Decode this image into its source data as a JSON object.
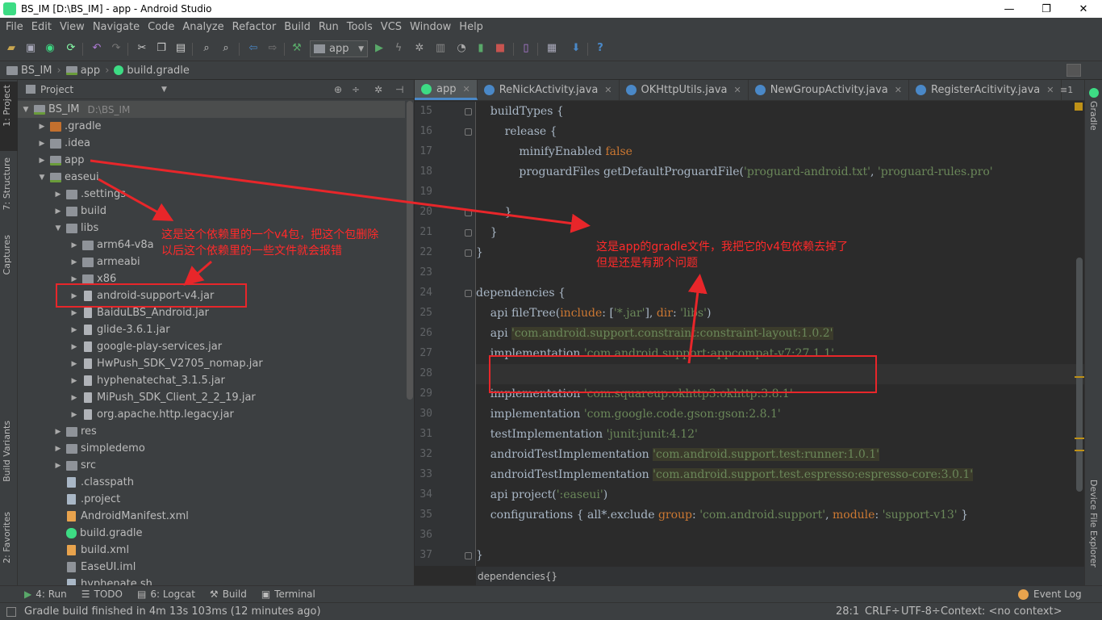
{
  "window": {
    "title": "BS_IM [D:\\BS_IM] - app - Android Studio",
    "controls": [
      "—",
      "❐",
      "✕"
    ]
  },
  "menu": [
    "File",
    "Edit",
    "View",
    "Navigate",
    "Code",
    "Analyze",
    "Refactor",
    "Build",
    "Run",
    "Tools",
    "VCS",
    "Window",
    "Help"
  ],
  "toolbar": {
    "run_config": "app"
  },
  "breadcrumb": [
    "BS_IM",
    "app",
    "build.gradle"
  ],
  "left_strip": {
    "project": "1: Project",
    "structure": "7: Structure",
    "captures": "Captures",
    "build_variants": "Build Variants",
    "favorites": "2: Favorites"
  },
  "right_strip": {
    "gradle": "Gradle",
    "device_explorer": "Device File Explorer"
  },
  "project_panel": {
    "view": "Project",
    "root": {
      "name": "BS_IM",
      "path": "D:\\BS_IM"
    },
    "tree": [
      {
        "label": "BS_IM",
        "extra": "D:\\BS_IM",
        "depth": 0,
        "arrow": "down",
        "icon": "mod"
      },
      {
        "label": ".gradle",
        "depth": 1,
        "arrow": "right",
        "icon": "ofolder"
      },
      {
        "label": ".idea",
        "depth": 1,
        "arrow": "right",
        "icon": "folder"
      },
      {
        "label": "app",
        "depth": 1,
        "arrow": "right",
        "icon": "mod"
      },
      {
        "label": "easeui",
        "depth": 1,
        "arrow": "down",
        "icon": "mod"
      },
      {
        "label": ".settings",
        "depth": 2,
        "arrow": "right",
        "icon": "folder"
      },
      {
        "label": "build",
        "depth": 2,
        "arrow": "right",
        "icon": "folder"
      },
      {
        "label": "libs",
        "depth": 2,
        "arrow": "down",
        "icon": "folder"
      },
      {
        "label": "arm64-v8a",
        "depth": 3,
        "arrow": "right",
        "icon": "folder"
      },
      {
        "label": "armeabi",
        "depth": 3,
        "arrow": "right",
        "icon": "folder"
      },
      {
        "label": "x86",
        "depth": 3,
        "arrow": "right",
        "icon": "folder"
      },
      {
        "label": "android-support-v4.jar",
        "depth": 3,
        "arrow": "right",
        "icon": "jar"
      },
      {
        "label": "BaiduLBS_Android.jar",
        "depth": 3,
        "arrow": "right",
        "icon": "jar"
      },
      {
        "label": "glide-3.6.1.jar",
        "depth": 3,
        "arrow": "right",
        "icon": "jar"
      },
      {
        "label": "google-play-services.jar",
        "depth": 3,
        "arrow": "right",
        "icon": "jar"
      },
      {
        "label": "HwPush_SDK_V2705_nomap.jar",
        "depth": 3,
        "arrow": "right",
        "icon": "jar"
      },
      {
        "label": "hyphenatechat_3.1.5.jar",
        "depth": 3,
        "arrow": "right",
        "icon": "jar"
      },
      {
        "label": "MiPush_SDK_Client_2_2_19.jar",
        "depth": 3,
        "arrow": "right",
        "icon": "jar"
      },
      {
        "label": "org.apache.http.legacy.jar",
        "depth": 3,
        "arrow": "right",
        "icon": "jar"
      },
      {
        "label": "res",
        "depth": 2,
        "arrow": "right",
        "icon": "folder"
      },
      {
        "label": "simpledemo",
        "depth": 2,
        "arrow": "right",
        "icon": "folder"
      },
      {
        "label": "src",
        "depth": 2,
        "arrow": "right",
        "icon": "folder"
      },
      {
        "label": ".classpath",
        "depth": 2,
        "arrow": "none",
        "icon": "file"
      },
      {
        "label": ".project",
        "depth": 2,
        "arrow": "none",
        "icon": "file"
      },
      {
        "label": "AndroidManifest.xml",
        "depth": 2,
        "arrow": "none",
        "icon": "xml"
      },
      {
        "label": "build.gradle",
        "depth": 2,
        "arrow": "none",
        "icon": "grad"
      },
      {
        "label": "build.xml",
        "depth": 2,
        "arrow": "none",
        "icon": "xml"
      },
      {
        "label": "EaseUI.iml",
        "depth": 2,
        "arrow": "none",
        "icon": "iml"
      },
      {
        "label": "hyphenate.sh",
        "depth": 2,
        "arrow": "none",
        "icon": "file"
      }
    ]
  },
  "editor": {
    "tabs": [
      {
        "label": "app",
        "active": true,
        "color": "#3ddc84"
      },
      {
        "label": "ReNickActivity.java",
        "active": false,
        "color": "#4a88c7"
      },
      {
        "label": "OKHttpUtils.java",
        "active": false,
        "color": "#4a88c7"
      },
      {
        "label": "NewGroupActivity.java",
        "active": false,
        "color": "#4a88c7"
      },
      {
        "label": "RegisterAcitivity.java",
        "active": false,
        "color": "#4a88c7"
      }
    ],
    "tab_menu": "≡1",
    "lines": [
      {
        "n": "15",
        "segs": [
          [
            "    buildTypes {",
            ""
          ]
        ]
      },
      {
        "n": "16",
        "segs": [
          [
            "        release {",
            ""
          ]
        ]
      },
      {
        "n": "17",
        "segs": [
          [
            "            minifyEnabled ",
            ""
          ],
          [
            "false",
            "kw"
          ]
        ]
      },
      {
        "n": "18",
        "segs": [
          [
            "            proguardFiles getDefaultProguardFile(",
            ""
          ],
          [
            "'proguard-android.txt'",
            "str"
          ],
          [
            ", ",
            ""
          ],
          [
            "'proguard-rules.pro'",
            "str"
          ]
        ]
      },
      {
        "n": "19",
        "segs": [
          [
            "",
            ""
          ]
        ]
      },
      {
        "n": "20",
        "segs": [
          [
            "        }",
            ""
          ]
        ]
      },
      {
        "n": "21",
        "segs": [
          [
            "    }",
            ""
          ]
        ]
      },
      {
        "n": "22",
        "segs": [
          [
            "}",
            ""
          ]
        ]
      },
      {
        "n": "23",
        "segs": [
          [
            "",
            ""
          ]
        ]
      },
      {
        "n": "24",
        "segs": [
          [
            "dependencies {",
            ""
          ]
        ]
      },
      {
        "n": "25",
        "segs": [
          [
            "    api fileTree(",
            ""
          ],
          [
            "include",
            "lit"
          ],
          [
            ": [",
            ""
          ],
          [
            "'*.jar'",
            "str"
          ],
          [
            "], ",
            ""
          ],
          [
            "dir",
            "lit"
          ],
          [
            ": ",
            ""
          ],
          [
            "'libs'",
            "str"
          ],
          [
            ")",
            ""
          ]
        ]
      },
      {
        "n": "26",
        "segs": [
          [
            "    api ",
            ""
          ],
          [
            "'com.android.support.constraint:constraint-layout:1.0.2'",
            "str hl"
          ]
        ]
      },
      {
        "n": "27",
        "segs": [
          [
            "    implementation ",
            ""
          ],
          [
            "'com.android.support:appcompat-v7:27.1.1'",
            "str"
          ]
        ]
      },
      {
        "n": "28",
        "segs": [
          [
            "",
            ""
          ]
        ]
      },
      {
        "n": "29",
        "segs": [
          [
            "    implementation ",
            ""
          ],
          [
            "'com.squareup.okhttp3:okhttp:3.8.1'",
            "str"
          ]
        ]
      },
      {
        "n": "30",
        "segs": [
          [
            "    implementation ",
            ""
          ],
          [
            "'com.google.code.gson:gson:2.8.1'",
            "str"
          ]
        ]
      },
      {
        "n": "31",
        "segs": [
          [
            "    testImplementation ",
            ""
          ],
          [
            "'junit:junit:4.12'",
            "str"
          ]
        ]
      },
      {
        "n": "32",
        "segs": [
          [
            "    androidTestImplementation ",
            ""
          ],
          [
            "'com.android.support.test:runner:1.0.1'",
            "str hl"
          ]
        ]
      },
      {
        "n": "33",
        "segs": [
          [
            "    androidTestImplementation ",
            ""
          ],
          [
            "'com.android.support.test.espresso:espresso-core:3.0.1'",
            "str hl"
          ]
        ]
      },
      {
        "n": "34",
        "segs": [
          [
            "    api project(",
            ""
          ],
          [
            "':easeui'",
            "str"
          ],
          [
            ")",
            ""
          ]
        ]
      },
      {
        "n": "35",
        "segs": [
          [
            "    configurations { all*.exclude ",
            ""
          ],
          [
            "group",
            "lit"
          ],
          [
            ": ",
            ""
          ],
          [
            "'com.android.support'",
            "str"
          ],
          [
            ", ",
            ""
          ],
          [
            "module",
            "lit"
          ],
          [
            ": ",
            ""
          ],
          [
            "'support-v13'",
            "str"
          ],
          [
            " }",
            ""
          ]
        ]
      },
      {
        "n": "36",
        "segs": [
          [
            "",
            ""
          ]
        ]
      },
      {
        "n": "37",
        "segs": [
          [
            "}",
            ""
          ]
        ]
      }
    ],
    "breadcrumb": "dependencies{}"
  },
  "annotations": {
    "left_note": [
      "这是这个依赖里的一个v4包，把这个包删除",
      "以后这个依赖里的一些文件就会报错"
    ],
    "right_note": [
      "这是app的gradle文件，我把它的v4包依赖去掉了",
      "但是还是有那个问题"
    ]
  },
  "bottom_tools": [
    {
      "label": "4: Run",
      "icon": "▶",
      "color": "#59a869"
    },
    {
      "label": "TODO",
      "icon": "☰",
      "color": "#bbbbbb"
    },
    {
      "label": "6: Logcat",
      "icon": "▤",
      "color": "#bbbbbb"
    },
    {
      "label": "Build",
      "icon": "⚒",
      "color": "#bbbbbb"
    },
    {
      "label": "Terminal",
      "icon": "▣",
      "color": "#bbbbbb"
    }
  ],
  "event_log": "Event Log",
  "status": {
    "message": "Gradle build finished in 4m 13s 103ms (12 minutes ago)",
    "position": "28:1",
    "line_sep": "CRLF÷",
    "encoding": "UTF-8÷",
    "context": "Context: <no context>"
  },
  "colors": {
    "bg": "#2b2b2b",
    "panel": "#3c3f41",
    "accent": "#4a88c7",
    "annotation": "#ff2a2a",
    "keyword": "#cc7832",
    "string": "#6a8759"
  }
}
